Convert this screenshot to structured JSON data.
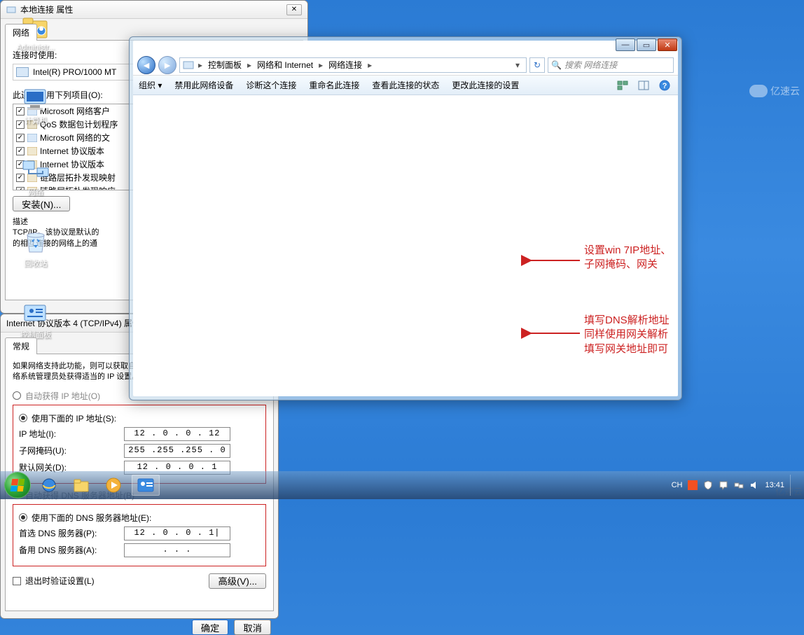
{
  "desktop": {
    "icons": [
      {
        "name": "administrator",
        "label": "Administr..."
      },
      {
        "name": "computer",
        "label": "计算机"
      },
      {
        "name": "network",
        "label": "网络"
      },
      {
        "name": "recycle",
        "label": "回收站"
      },
      {
        "name": "control-panel",
        "label": "控制面板"
      }
    ]
  },
  "explorer": {
    "breadcrumb": [
      "控制面板",
      "网络和 Internet",
      "网络连接"
    ],
    "search_placeholder": "搜索 网络连接",
    "toolbar": {
      "org": "组织 ▾",
      "disable": "禁用此网络设备",
      "diagnose": "诊断这个连接",
      "rename": "重命名此连接",
      "status": "查看此连接的状态",
      "change": "更改此连接的设置"
    }
  },
  "local_conn": {
    "title": "本地连接 属性",
    "tab": "网络",
    "connect_using": "连接时使用:",
    "adapter": "Intel(R) PRO/1000 MT",
    "uses_items_label": "此连接使用下列项目(O):",
    "items": [
      "Microsoft 网络客户",
      "QoS 数据包计划程序",
      "Microsoft 网络的文",
      "Internet 协议版本",
      "Internet 协议版本",
      "链路层拓扑发现映射",
      "链路层拓扑发现响应"
    ],
    "install_btn": "安装(N)...",
    "desc_label": "描述",
    "desc_text": "TCP/IP。该协议是默认的\n的相互连接的网络上的通"
  },
  "ipv4": {
    "title": "Internet 协议版本 4 (TCP/IPv4) 属性",
    "tab": "常规",
    "intro": "如果网络支持此功能，则可以获取自动指派的 IP 设置。否则，您需要从网络系统管理员处获得适当的 IP 设置。",
    "auto_ip": "自动获得 IP 地址(O)",
    "manual_ip": "使用下面的 IP 地址(S):",
    "ip_label": "IP 地址(I):",
    "ip_value": "12 .  0 .  0 . 12",
    "mask_label": "子网掩码(U):",
    "mask_value": "255 .255 .255 .  0",
    "gw_label": "默认网关(D):",
    "gw_value": "12 .  0 .  0 .  1",
    "auto_dns": "自动获得 DNS 服务器地址(B)",
    "manual_dns": "使用下面的 DNS 服务器地址(E):",
    "dns1_label": "首选 DNS 服务器(P):",
    "dns1_value": "12 .  0 .  0 .  1|",
    "dns2_label": "备用 DNS 服务器(A):",
    "dns2_value": " .    .    .   ",
    "validate": "退出时验证设置(L)",
    "advanced": "高级(V)...",
    "ok": "确定",
    "cancel": "取消"
  },
  "annotations": {
    "a1_line1": "设置win 7IP地址、",
    "a1_line2": "子网掩码、网关",
    "a2_line1": "填写DNS解析地址",
    "a2_line2": "同样使用网关解析",
    "a2_line3": "填写网关地址即可"
  },
  "watermark": "亿速云",
  "taskbar": {
    "lang": "CH",
    "time": "13:41"
  }
}
